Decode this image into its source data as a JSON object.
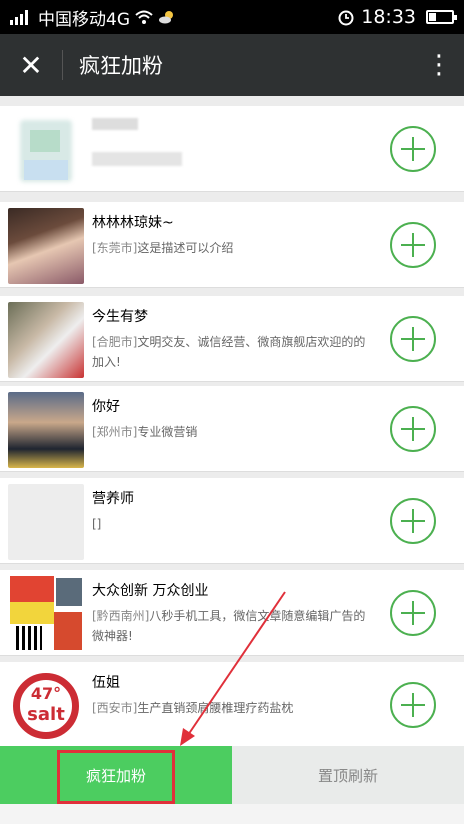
{
  "status_bar": {
    "carrier": "中国移动4G",
    "time": "18:33"
  },
  "header": {
    "title": "疯狂加粉"
  },
  "contacts": [
    {
      "name": "",
      "city": "",
      "desc": ""
    },
    {
      "name": "林林林琼妹~",
      "city": "[东莞市]",
      "desc": "这是描述可以介绍"
    },
    {
      "name": "今生有梦",
      "city": "[合肥市]",
      "desc": "文明交友、诚信经营、微商旗舰店欢迎的的加入!"
    },
    {
      "name": "你好",
      "city": "[郑州市]",
      "desc": "专业微营销"
    },
    {
      "name": "营养师",
      "city": "",
      "desc": "[]"
    },
    {
      "name": "大众创新 万众创业",
      "city": "[黔西南州]",
      "desc": "八秒手机工具，微信文章随意编辑广告的微神器!"
    },
    {
      "name": "伍姐",
      "city": "[西安市]",
      "desc": "生产直销颈肩腰椎理疗药盐枕"
    }
  ],
  "avatar_texts": {
    "salt_top": "47°",
    "salt_bottom": "salt"
  },
  "bottom": {
    "crazy_label": "疯狂加粉",
    "top_refresh_label": "置顶刷新"
  },
  "colors": {
    "accent_green": "#4ccd60",
    "annotation_red": "#e0303a",
    "title_bar": "#2e3132"
  }
}
